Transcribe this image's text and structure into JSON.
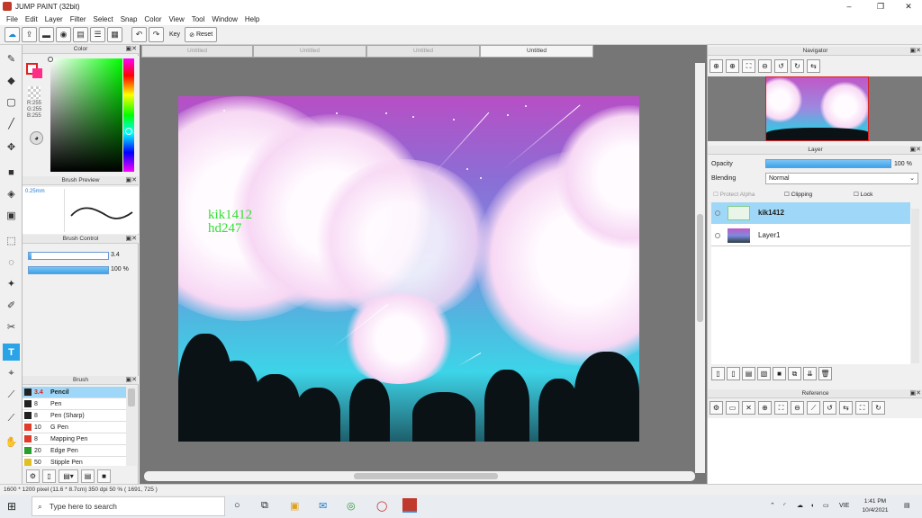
{
  "window": {
    "title": "JUMP PAINT (32bit)",
    "minimize": "–",
    "maximize": "❐",
    "close": "✕"
  },
  "menu": [
    "File",
    "Edit",
    "Layer",
    "Filter",
    "Select",
    "Snap",
    "Color",
    "View",
    "Tool",
    "Window",
    "Help"
  ],
  "toolbar": {
    "key_label": "Key",
    "reset_label": "Reset"
  },
  "tabs": [
    "Untitled",
    "Untitled",
    "Untitled",
    "Untitled"
  ],
  "color_panel": {
    "title": "Color",
    "rgb": "R:255\nG:255\nB:255",
    "fg": "#ffffff",
    "bg": "#ff2d88"
  },
  "brush_preview": {
    "title": "Brush Preview",
    "size": "0.25mm"
  },
  "brush_control": {
    "title": "Brush Control",
    "size": "3.4",
    "opacity": "100 %"
  },
  "brush": {
    "title": "Brush",
    "items": [
      {
        "size": "3.4",
        "name": "Pencil",
        "color": "#222222",
        "selected": true
      },
      {
        "size": "8",
        "name": "Pen",
        "color": "#222222"
      },
      {
        "size": "8",
        "name": "Pen (Sharp)",
        "color": "#222222"
      },
      {
        "size": "10",
        "name": "G Pen",
        "color": "#e03a2a"
      },
      {
        "size": "8",
        "name": "Mapping Pen",
        "color": "#e03a2a"
      },
      {
        "size": "20",
        "name": "Edge Pen",
        "color": "#2aa02a"
      },
      {
        "size": "50",
        "name": "Stipple Pen",
        "color": "#e0c020"
      }
    ]
  },
  "artwork": {
    "signature_line1": "kik1412",
    "signature_line2": "hd247"
  },
  "navigator": {
    "title": "Navigator"
  },
  "layer_panel": {
    "title": "Layer",
    "opacity_label": "Opacity",
    "opacity_value": "100 %",
    "blending_label": "Blending",
    "blending_value": "Normal",
    "protect_alpha": "Protect Alpha",
    "clipping": "Clipping",
    "lock": "Lock",
    "layers": [
      {
        "name": "kik1412",
        "selected": true
      },
      {
        "name": "Layer1",
        "selected": false
      }
    ]
  },
  "reference": {
    "title": "Reference"
  },
  "status": {
    "text": "1600 * 1200 pixel  (11.6 * 8.7cm)  350 dpi  50 %  ( 1691, 725 )"
  },
  "taskbar": {
    "search_placeholder": "Type here to search",
    "lang": "VIE",
    "time": "1:41 PM",
    "date": "10/4/2021"
  }
}
